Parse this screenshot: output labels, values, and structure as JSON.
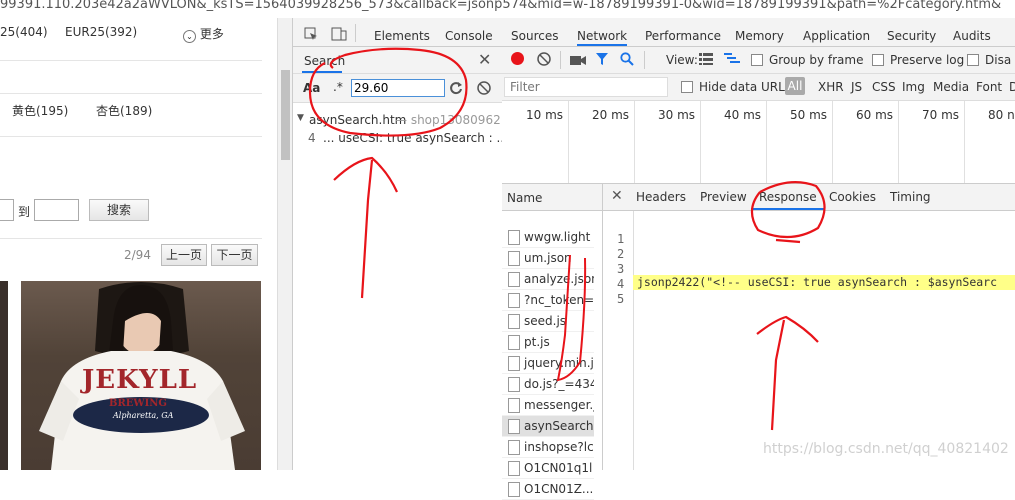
{
  "url_bar": {
    "text": "99391.110.203e42a2aWVLON&_ksTS=1564039928256_573&callback=jsonp574&mid=w-18789199391-0&wid=18789199391&path=%2Fcategory.htm&"
  },
  "page": {
    "filters_row1": [
      "25(404)",
      "EUR25(392)"
    ],
    "more_label": "更多",
    "colors_row": [
      "黄色(195)",
      "杏色(189)"
    ],
    "price_to": "到",
    "search_btn": "搜索",
    "pager": {
      "text": "2/94",
      "prev": "上一页",
      "next": "下一页"
    },
    "product_text": {
      "brand": "JEKYLL",
      "sub": "BREWING",
      "tag": "Alpharetta, GA"
    }
  },
  "devtools": {
    "tabs": [
      "Elements",
      "Console",
      "Sources",
      "Network",
      "Performance",
      "Memory",
      "Application",
      "Security",
      "Audits"
    ],
    "active_tab": "Network",
    "search": {
      "title": "Search",
      "case_label": "Aa",
      "regex_label": ".*",
      "query": "29.60",
      "result_file": "asynSearch.htm",
      "result_path": "— shop13080962...",
      "result_line_no": "4",
      "result_line": "...   useCSI: true   asynSearch : ..."
    },
    "network": {
      "view_label": "View:",
      "group_by_frame": "Group by frame",
      "preserve_log": "Preserve log",
      "disable_cache": "Disa",
      "filter_placeholder": "Filter",
      "hide_data_urls": "Hide data URLs",
      "type_filters": [
        "All",
        "XHR",
        "JS",
        "CSS",
        "Img",
        "Media",
        "Font",
        "D"
      ],
      "timeline_ticks": [
        "10 ms",
        "20 ms",
        "30 ms",
        "40 ms",
        "50 ms",
        "60 ms",
        "70 ms",
        "80 n"
      ],
      "name_header": "Name",
      "requests": [
        "wwgw.light",
        "um.json",
        "analyze.json",
        "?nc_token=",
        "seed.js",
        "pt.js",
        "jquery.min.j",
        "do.js?_=434",
        "messenger.j",
        "asynSearch",
        "inshopse?lc",
        "O1CN01q1l",
        "O1CN01Z..."
      ],
      "selected_request": "asynSearch",
      "detail_tabs": [
        "Headers",
        "Preview",
        "Response",
        "Cookies",
        "Timing"
      ],
      "active_detail_tab": "Response",
      "response_lines": [
        "1",
        "2",
        "3",
        "4",
        "5"
      ],
      "response_line4": "jsonp2422(\"<!--    useCSI: true   asynSearch : $asynSearc"
    }
  },
  "watermark": "https://blog.csdn.net/qq_40821402",
  "colors": {
    "accent": "#1a73e8",
    "annotation": "#e8141a",
    "highlight": "#ffff88",
    "record": "#e8141a"
  }
}
